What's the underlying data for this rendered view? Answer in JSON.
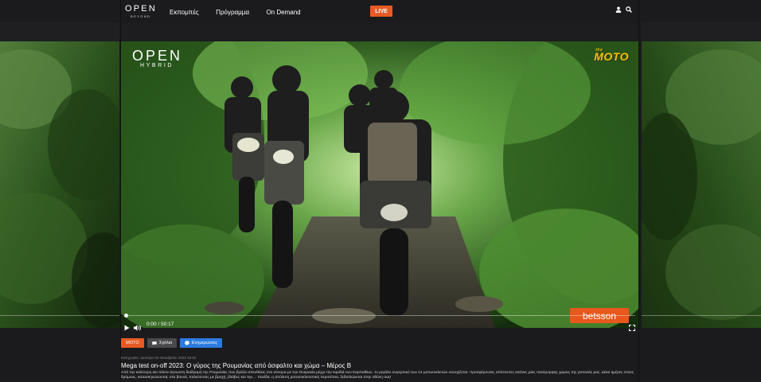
{
  "header": {
    "logo_main": "OPEN",
    "logo_sub": "BEYOND",
    "nav": [
      "Εκπομπές",
      "Πρόγραμμα",
      "On Demand"
    ],
    "live_label": "LIVE",
    "icons": [
      "user-icon",
      "search-icon"
    ]
  },
  "video": {
    "channel_logo_main": "OPEN",
    "channel_logo_sub": "HYBRID",
    "show_logo_prefix": "the",
    "show_logo": "MOTO",
    "sponsor": "betsson",
    "current_time": "0:00",
    "separator": "/",
    "duration": "50:17",
    "progress": 0.0,
    "icons": [
      "play-icon",
      "volume-icon",
      "fullscreen-icon"
    ]
  },
  "tags": {
    "category": "MOTO",
    "comments_label": "Σχόλια",
    "notify_label": "Ενημερώσεις"
  },
  "article": {
    "meta": "Κατηγορίες: Δευτέρα 02 Οκτωβρίου 2023 18:52",
    "title": "Mega test on-off 2023: Ο γύρος της Ρουμανίας από άσφαλτο και χώμα – Μέρος Β",
    "description": "Από την καλύτερη και πλέον άγνωστη διαδρομή της Ρουμανίας που βγάζει απευθείας στα σύνορα με την Ουκρανία μέχρι την καρδιά των Καρπαθίων, το μεγάλο συγκριτικό των 14 μοτοσυκλετών συνεχίζεται: προσφέροντας απίστευτες εικόνες μίας πανέμορφης χώρας της γειτονιάς μας. Δέκα ημέρες στους δρόμους, κατασκηνώνοντας στα βουνά, παλεύοντας με βροχή, βλάβες και την.... πανίδα, η απόλυτη μοτοσυκλετιστική περιπέτεια, ξεδιπλώνεται στην οθόνη σας!"
  },
  "colors": {
    "accent": "#e85a23",
    "notify": "#2b7be0",
    "background": "#1b1b1d"
  }
}
